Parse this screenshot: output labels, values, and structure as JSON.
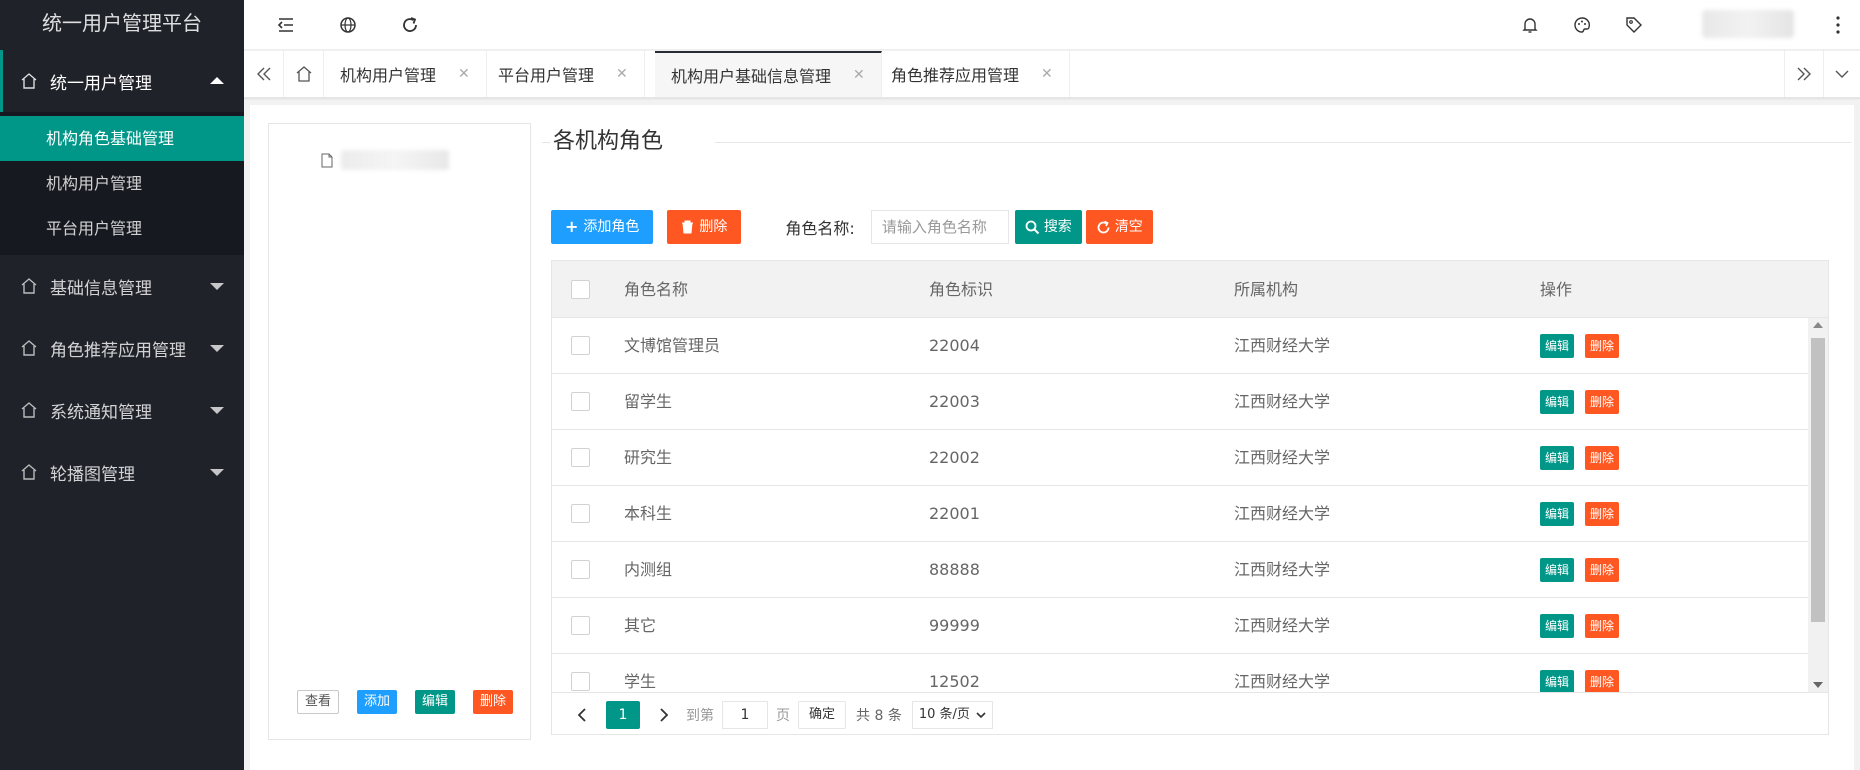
{
  "app": {
    "title": "统一用户管理平台"
  },
  "sidebar": {
    "groups": [
      {
        "label": "统一用户管理",
        "open": true,
        "items": [
          {
            "label": "机构角色基础管理",
            "active": true
          },
          {
            "label": "机构用户管理",
            "active": false
          },
          {
            "label": "平台用户管理",
            "active": false
          }
        ]
      },
      {
        "label": "基础信息管理",
        "open": false
      },
      {
        "label": "角色推荐应用管理",
        "open": false
      },
      {
        "label": "系统通知管理",
        "open": false
      },
      {
        "label": "轮播图管理",
        "open": false
      }
    ]
  },
  "topbar": {
    "icons": [
      "menu-fold-icon",
      "globe-icon",
      "refresh-icon",
      "bell-icon",
      "palette-icon",
      "tag-icon",
      "more-vertical-icon"
    ]
  },
  "tabs": [
    {
      "label": "机构用户管理",
      "active": false
    },
    {
      "label": "平台用户管理",
      "active": false
    },
    {
      "label": "机构用户基础信息管理",
      "active": true
    },
    {
      "label": "角色推荐应用管理",
      "active": false
    }
  ],
  "tree": {
    "actions": {
      "view": "查看",
      "add": "添加",
      "edit": "编辑",
      "delete": "删除"
    }
  },
  "main": {
    "section_title": "各机构角色",
    "toolbar": {
      "add_role": "添加角色",
      "delete": "删除",
      "role_name_label": "角色名称:",
      "search_placeholder": "请输入角色名称",
      "search": "搜索",
      "clear": "清空"
    },
    "table": {
      "columns": [
        "角色名称",
        "角色标识",
        "所属机构",
        "操作"
      ],
      "rows": [
        {
          "name": "文博馆管理员",
          "code": "22004",
          "org": "江西财经大学"
        },
        {
          "name": "留学生",
          "code": "22003",
          "org": "江西财经大学"
        },
        {
          "name": "研究生",
          "code": "22002",
          "org": "江西财经大学"
        },
        {
          "name": "本科生",
          "code": "22001",
          "org": "江西财经大学"
        },
        {
          "name": "内测组",
          "code": "88888",
          "org": "江西财经大学"
        },
        {
          "name": "其它",
          "code": "99999",
          "org": "江西财经大学"
        },
        {
          "name": "学生",
          "code": "12502",
          "org": "江西财经大学"
        }
      ],
      "row_actions": {
        "edit": "编辑",
        "delete": "删除"
      }
    },
    "pager": {
      "current": "1",
      "goto_label": "到第",
      "goto_value": "1",
      "page_unit": "页",
      "confirm": "确定",
      "total": "共 8 条",
      "page_size": "10 条/页"
    }
  },
  "colors": {
    "sidebar_bg": "#20222a",
    "accent": "#009688",
    "primary": "#1e9fff",
    "danger": "#ff5722"
  }
}
